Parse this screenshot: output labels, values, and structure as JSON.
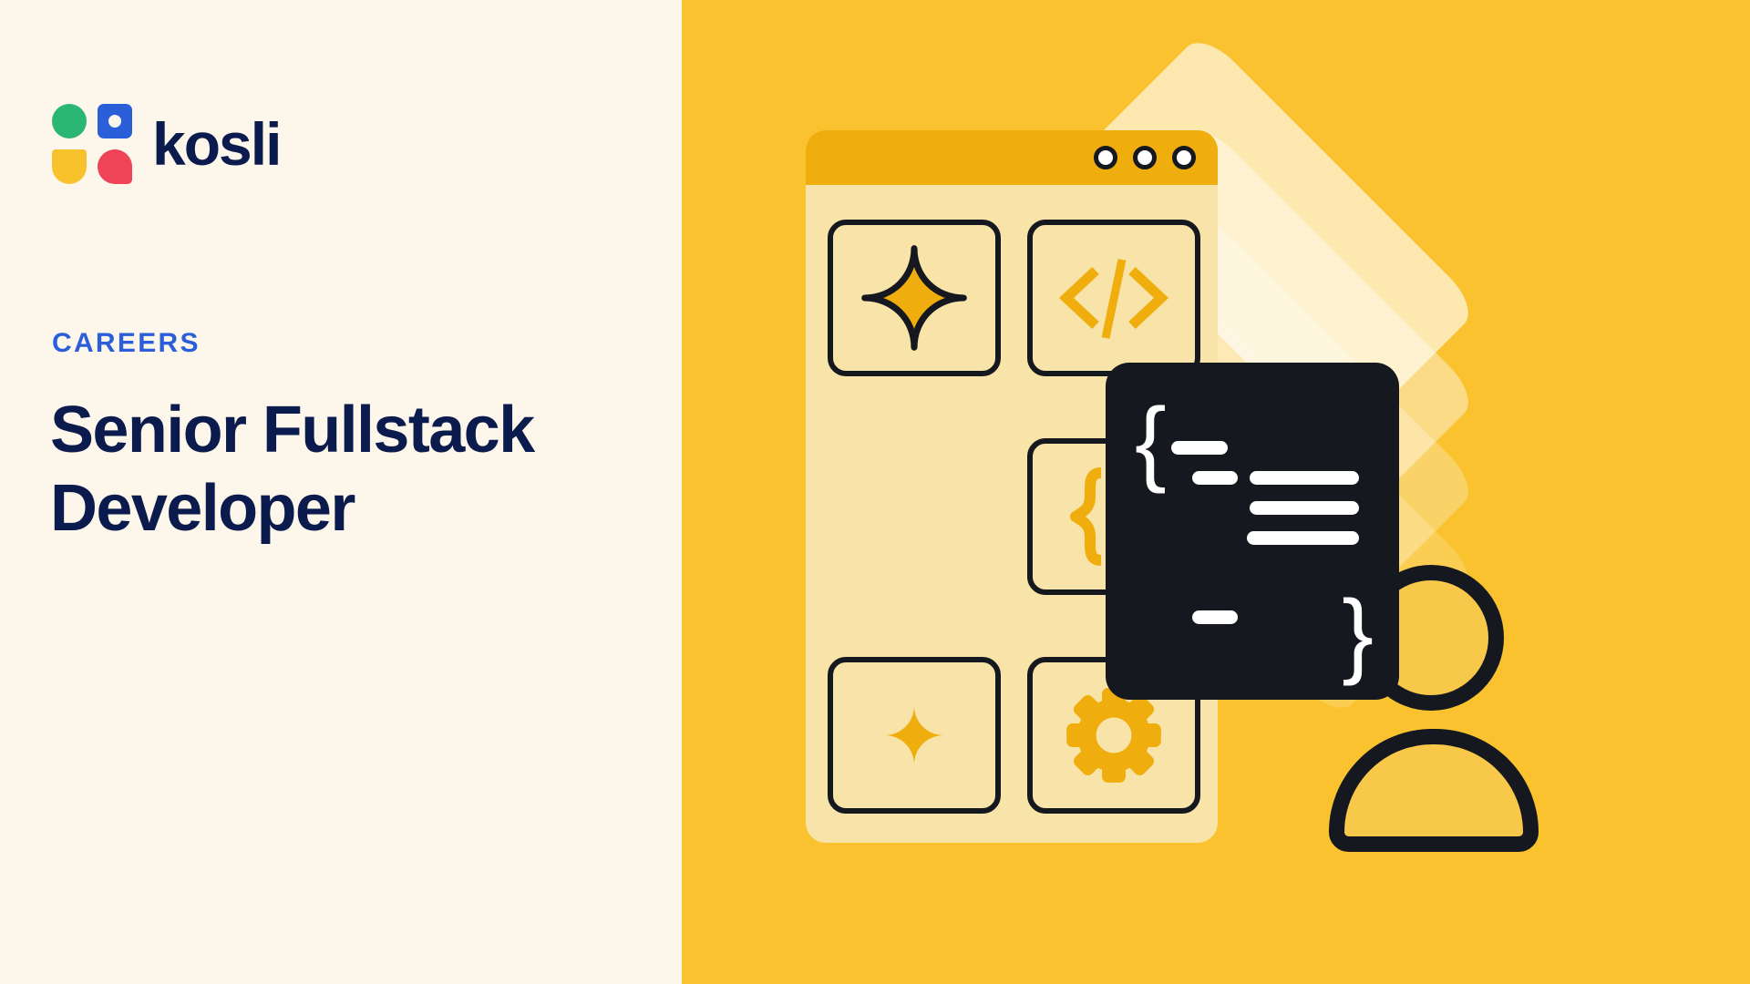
{
  "brand": {
    "name": "kosli",
    "logo_icon": "kosli-logo-mark",
    "mark_colors": {
      "green_circle": "#2BB673",
      "blue_square": "#2B5FD9",
      "yellow_half": "#F8C22D",
      "red_drop": "#EF4358"
    },
    "wordmark_color": "#0C1B4D"
  },
  "left": {
    "eyebrow": "CAREERS",
    "eyebrow_color": "#2B5FD9",
    "headline": "Senior Fullstack Developer",
    "headline_color": "#0C1B4D",
    "background_color": "#FDF6EA"
  },
  "right": {
    "background_color": "#F9C22E",
    "illustration_name": "developer-workspace-illustration",
    "window": {
      "titlebar_color": "#EFAE0E",
      "body_color": "#F8E3A8",
      "dots": [
        {
          "name": "window-dot-1"
        },
        {
          "name": "window-dot-2"
        },
        {
          "name": "window-dot-3"
        }
      ],
      "tiles": [
        {
          "position": "top-left",
          "icon": "four-point-star-outline-icon",
          "icon_color": "#EFAE0E"
        },
        {
          "position": "top-right",
          "icon": "code-tag-icon",
          "icon_color": "#EFAE0E"
        },
        {
          "position": "middle-right",
          "icon": "curly-braces-icon",
          "icon_color": "#EFAE0E"
        },
        {
          "position": "bottom-left",
          "icon": "four-point-star-small-icon",
          "icon_color": "#EFAE0E"
        },
        {
          "position": "bottom-right",
          "icon": "gear-icon",
          "icon_color": "#EFAE0E"
        }
      ]
    },
    "code_card": {
      "name": "code-snippet-card",
      "background_color": "#15181E",
      "line_color": "#FFFFFF",
      "open_brace": "{",
      "close_brace": "}",
      "line_count": 6
    },
    "layer_stack": {
      "name": "layered-diamond-stack",
      "layer_count": 4,
      "layer_color": "#FFFFFF"
    },
    "person": {
      "name": "user-avatar-icon",
      "outline_color": "#15181E",
      "fill_color": "#F8C84B"
    }
  }
}
